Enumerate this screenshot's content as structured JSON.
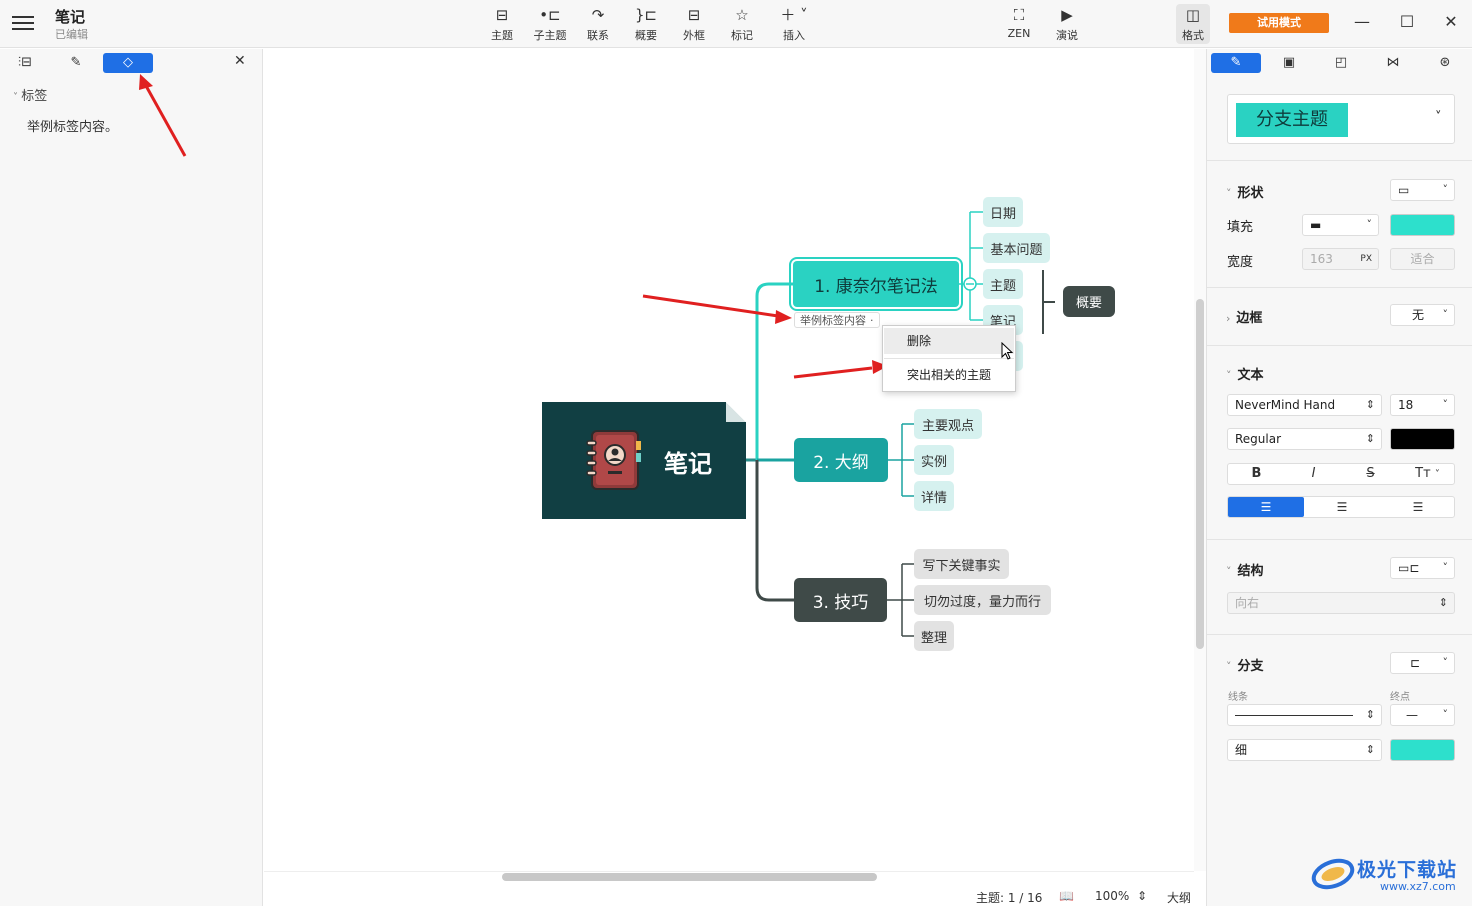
{
  "app": {
    "title": "笔记",
    "status": "已编辑"
  },
  "toolbar": {
    "items": [
      {
        "label": "主题",
        "icon": "topic-icon"
      },
      {
        "label": "子主题",
        "icon": "subtopic-icon"
      },
      {
        "label": "联系",
        "icon": "relationship-icon"
      },
      {
        "label": "概要",
        "icon": "summary-icon"
      },
      {
        "label": "外框",
        "icon": "boundary-icon"
      },
      {
        "label": "标记",
        "icon": "star-icon"
      },
      {
        "label": "插入",
        "icon": "plus-icon"
      }
    ],
    "zen": "ZEN",
    "present": "演说",
    "format": "格式",
    "trial": "试用模式"
  },
  "left_panel": {
    "section": "标签",
    "tag_item": "举例标签内容。"
  },
  "mindmap": {
    "central": "笔记",
    "topics": [
      {
        "label": "1. 康奈尔笔记法",
        "subs": [
          "日期",
          "基本问题",
          "主题",
          "笔记"
        ]
      },
      {
        "label": "2. 大纲",
        "subs": [
          "主要观点",
          "实例",
          "详情"
        ]
      },
      {
        "label": "3. 技巧",
        "subs": [
          "写下关键事实",
          "切勿过度，量力而行",
          "整理"
        ]
      }
    ],
    "summary": "概要",
    "tag_label": "举例标签内容"
  },
  "context_menu": {
    "delete": "删除",
    "highlight": "突出相关的主题"
  },
  "statusbar": {
    "topic_count": "主题: 1 / 16",
    "zoom": "100%",
    "outline": "大纲"
  },
  "right_panel": {
    "style_preset": "分支主题",
    "shape": {
      "title": "形状"
    },
    "fill": {
      "label": "填充",
      "color": "#2de0cc"
    },
    "width": {
      "label": "宽度",
      "value": "163",
      "unit": "PX",
      "fit": "适合"
    },
    "border": {
      "title": "边框",
      "value": "无"
    },
    "text": {
      "title": "文本",
      "font": "NeverMind Hand",
      "size": "18",
      "weight": "Regular",
      "color": "#000000",
      "bold": "B",
      "italic": "I",
      "strike": "S",
      "case": "Tт"
    },
    "structure": {
      "title": "结构",
      "value": "向右"
    },
    "branch": {
      "title": "分支",
      "line_label": "线条",
      "end_label": "终点",
      "thickness": "细",
      "color": "#2de0cc"
    }
  },
  "watermark": {
    "brand": "极光下载站",
    "url": "www.xz7.com"
  },
  "colors": {
    "accent": "#1f6fe5",
    "topic_teal": "#2ad2c2",
    "topic_dark_teal": "#1aa3a0",
    "topic_dark": "#3f4a48",
    "central": "#113f43",
    "trial": "#f07a1a"
  }
}
